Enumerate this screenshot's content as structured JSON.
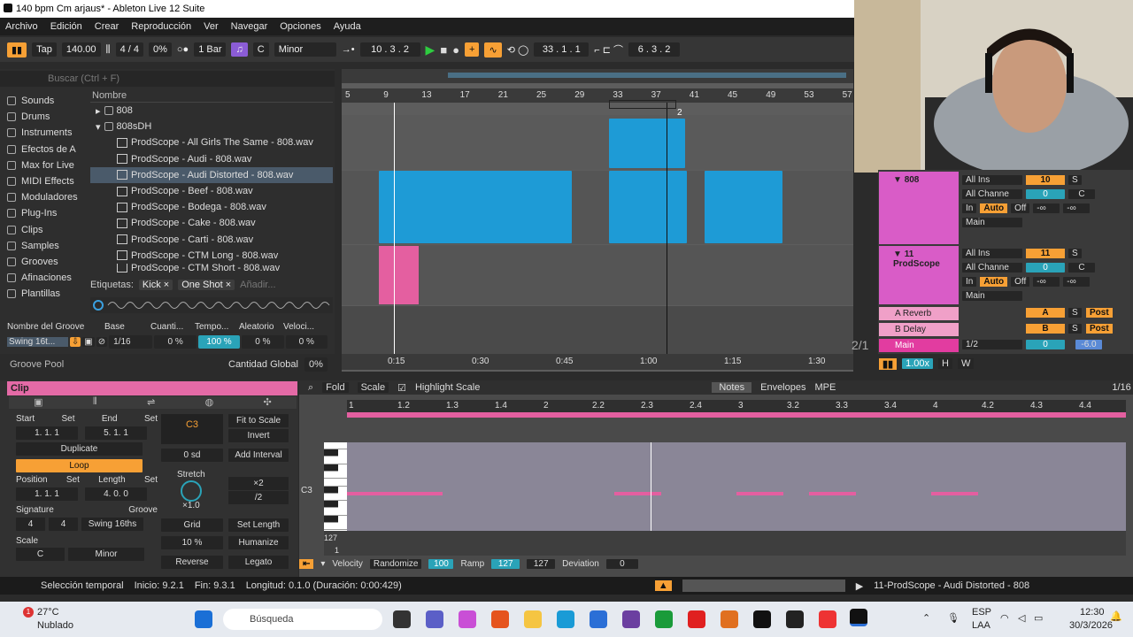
{
  "window": {
    "title": "140 bpm Cm arjaus* - Ableton Live 12 Suite"
  },
  "menu": [
    "Archivo",
    "Edición",
    "Crear",
    "Reproducción",
    "Ver",
    "Navegar",
    "Opciones",
    "Ayuda"
  ],
  "transport": {
    "tap": "Tap",
    "tempo": "140.00",
    "sig": "4 / 4",
    "groove": "0%",
    "quant": "1 Bar",
    "key": "C",
    "scale": "Minor",
    "pos": "10 .  3 .  2",
    "loop_start": "33 .  1 .  1",
    "loop_len": "6 .  3 .  2"
  },
  "browser": {
    "search_placeholder": "Buscar (Ctrl + F)",
    "places": [
      "Sounds",
      "Drums",
      "Instruments",
      "Efectos de A",
      "Max for Live",
      "MIDI Effects",
      "Moduladores",
      "Plug-Ins",
      "Clips",
      "Samples",
      "Grooves",
      "Afinaciones",
      "Plantillas"
    ],
    "col_header": "Nombre",
    "folders": [
      "808",
      "808sDH"
    ],
    "files": [
      "ProdScope - All Girls The Same - 808.wav",
      "ProdScope - Audi - 808.wav",
      "ProdScope - Audi Distorted - 808.wav",
      "ProdScope - Beef - 808.wav",
      "ProdScope - Bodega - 808.wav",
      "ProdScope - Cake - 808.wav",
      "ProdScope - Carti - 808.wav",
      "ProdScope - CTM Long - 808.wav",
      "ProdScope - CTM Short - 808.wav"
    ],
    "tags_label": "Etiquetas:",
    "tags": [
      "Kick",
      "One Shot"
    ],
    "tags_add": "Añadir..."
  },
  "groove": {
    "headers": [
      "Nombre del Groove",
      "Base",
      "Cuanti...",
      "Tempo...",
      "Aleatorio",
      "Veloci..."
    ],
    "row": [
      "Swing 16t...",
      "1/16",
      "0 %",
      "100 %",
      "0 %",
      "0 %"
    ],
    "pool": "Groove Pool",
    "global_label": "Cantidad Global",
    "global": "0%"
  },
  "arrangement": {
    "ruler": [
      "5",
      "9",
      "13",
      "17",
      "21",
      "25",
      "29",
      "33",
      "37",
      "41",
      "45",
      "49",
      "53",
      "57"
    ],
    "time": [
      "0:15",
      "0:30",
      "0:45",
      "1:00",
      "1:15",
      "1:30"
    ],
    "loop_marker": "2",
    "zoom": "1.00x",
    "page": "2/1"
  },
  "mixer": {
    "t1": {
      "name": "808",
      "input": "All Ins",
      "channel": "All Channe",
      "num": "10",
      "vol": "0",
      "pan": "C",
      "out": "Main",
      "in": "In",
      "auto": "Auto",
      "off": "Off",
      "sends": "-∞"
    },
    "t2": {
      "name": "11 ProdScope",
      "input": "All Ins",
      "channel": "All Channe",
      "num": "11",
      "vol": "0",
      "pan": "C",
      "out": "Main",
      "in": "In",
      "auto": "Auto",
      "off": "Off",
      "sends": "-∞"
    },
    "returns": [
      {
        "name": "A Reverb",
        "letter": "A"
      },
      {
        "name": "B Delay",
        "letter": "B"
      }
    ],
    "main": {
      "name": "Main",
      "frac": "1/2",
      "vol": "0",
      "db": "-6.0"
    },
    "solo": "S",
    "post": "Post",
    "h": "H",
    "w": "W"
  },
  "clip": {
    "header": "Clip",
    "start": "Start",
    "end": "End",
    "set": "Set",
    "start_val": "1.   1.   1",
    "end_val": "5.   1.   1",
    "duplicate": "Duplicate",
    "loop": "Loop",
    "position": "Position",
    "length": "Length",
    "pos_val": "1.   1.   1",
    "len_val": "4.   0.   0",
    "signature": "Signature",
    "sig_n": "4",
    "sig_d": "4",
    "groove": "Groove",
    "groove_val": "Swing 16ths",
    "scale": "Scale",
    "scale_key": "C",
    "scale_name": "Minor",
    "note": "C3",
    "sd": "0 sd",
    "fit": "Fit to Scale",
    "invert": "Invert",
    "add_interval": "Add Interval",
    "stretch": "Stretch",
    "x2": "×2",
    "half": "/2",
    "mult": "×1.0",
    "grid": "Grid",
    "set_length": "Set Length",
    "pct": "10 %",
    "humanize": "Humanize",
    "reverse": "Reverse",
    "legato": "Legato"
  },
  "editor": {
    "fold": "Fold",
    "scale": "Scale",
    "highlight": "Highlight Scale",
    "tabs": [
      "Notes",
      "Envelopes",
      "MPE"
    ],
    "grid": "1/16",
    "ruler": [
      "1",
      "1.2",
      "1.3",
      "1.4",
      "2",
      "2.2",
      "2.3",
      "2.4",
      "3",
      "3.2",
      "3.3",
      "3.4",
      "4",
      "4.2",
      "4.3",
      "4.4"
    ],
    "note_label": "C3",
    "vel_top": "127",
    "vel_bot": "1",
    "velocity": "Velocity",
    "randomize": "Randomize",
    "vel_val": "100",
    "ramp": "Ramp",
    "ramp1": "127",
    "ramp2": "127",
    "deviation": "Deviation",
    "dev_val": "0"
  },
  "status": {
    "sel": "Selección temporal",
    "start": "Inicio: 9.2.1",
    "end": "Fin: 9.3.1",
    "len": "Longitud: 0.1.0 (Duración: 0:00:429)",
    "track": "11-ProdScope - Audi Distorted - 808"
  },
  "taskbar": {
    "temp": "27°C",
    "weather": "Nublado",
    "badge": "1",
    "search": "Búsqueda",
    "lang1": "ESP",
    "lang2": "LAA",
    "time": "12:30",
    "date": "30/3/2026"
  },
  "colors": {
    "accent": "#f7a035",
    "clip_blue": "#1e9bd6",
    "clip_pink": "#e45fa0"
  }
}
